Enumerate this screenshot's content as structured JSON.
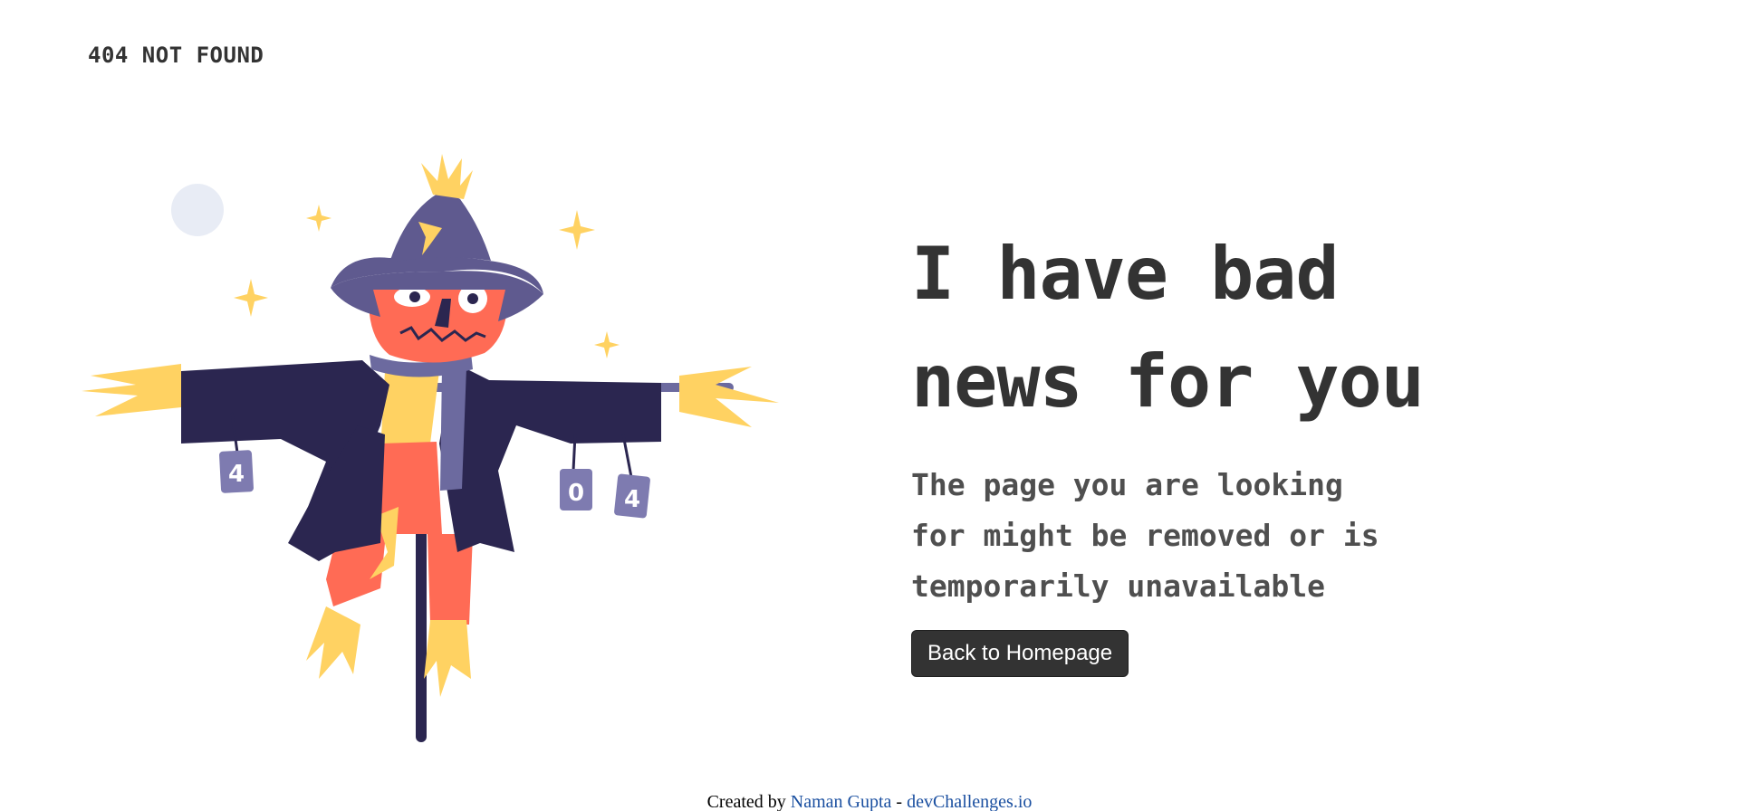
{
  "header": {
    "logo_text": "404 NOT FOUND"
  },
  "illustration": {
    "cans": [
      "4",
      "0",
      "4"
    ],
    "colors": {
      "hat": "#5f5a8f",
      "coat": "#2b2650",
      "face": "#ff6b55",
      "straw": "#ffd262",
      "scarf": "#6c6a9f",
      "can": "#7e7bb0",
      "moon": "#e8ecf5",
      "stick": "#2b2650"
    }
  },
  "main": {
    "headline": "I have bad news for you",
    "description": "The page you are looking for might be removed or is temporarily unavailable",
    "button_label": "Back to Homepage"
  },
  "footer": {
    "created_by": "Created by",
    "author": "Naman Gupta",
    "separator": "-",
    "site": "devChallenges.io"
  }
}
